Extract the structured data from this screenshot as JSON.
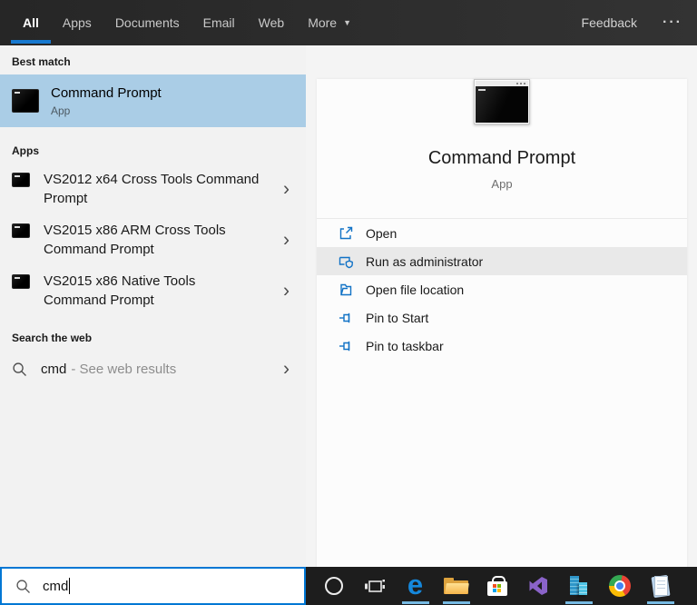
{
  "topbar": {
    "tabs": [
      {
        "label": "All",
        "active": true
      },
      {
        "label": "Apps",
        "active": false
      },
      {
        "label": "Documents",
        "active": false
      },
      {
        "label": "Email",
        "active": false
      },
      {
        "label": "Web",
        "active": false
      },
      {
        "label": "More",
        "active": false,
        "has_dropdown": true
      }
    ],
    "feedback": "Feedback",
    "overflow": "···"
  },
  "left": {
    "best_match": {
      "header": "Best match",
      "item": {
        "title": "Command Prompt",
        "subtitle": "App"
      }
    },
    "apps": {
      "header": "Apps",
      "items": [
        {
          "label": "VS2012 x64 Cross Tools Command Prompt"
        },
        {
          "label": "VS2015 x86 ARM Cross Tools Command Prompt"
        },
        {
          "label": "VS2015 x86 Native Tools Command Prompt"
        }
      ]
    },
    "web": {
      "header": "Search the web",
      "query": "cmd",
      "suffix": "- See web results"
    }
  },
  "preview": {
    "title": "Command Prompt",
    "subtitle": "App",
    "actions": [
      {
        "label": "Open",
        "highlighted": false
      },
      {
        "label": "Run as administrator",
        "highlighted": true
      },
      {
        "label": "Open file location",
        "highlighted": false
      },
      {
        "label": "Pin to Start",
        "highlighted": false
      },
      {
        "label": "Pin to taskbar",
        "highlighted": false
      }
    ]
  },
  "search": {
    "value": "cmd"
  },
  "taskbar": {
    "edge_glyph": "e",
    "icons": [
      {
        "name": "cortana",
        "running": false
      },
      {
        "name": "task-view",
        "running": false
      },
      {
        "name": "edge",
        "running": true
      },
      {
        "name": "file-explorer",
        "running": true
      },
      {
        "name": "store",
        "running": false
      },
      {
        "name": "visual-studio",
        "running": false
      },
      {
        "name": "server-manager",
        "running": true
      },
      {
        "name": "chrome",
        "running": false
      },
      {
        "name": "notepad",
        "running": true
      }
    ]
  },
  "glyphs": {
    "chevron": "›",
    "dropdown": "▼"
  },
  "colors": {
    "accent": "#0078d7",
    "best_match_highlight": "#aacde6",
    "action_highlight": "#e9e9e9",
    "topbar_bg": "#2b2b2b",
    "taskbar_bg": "#1d1d1d",
    "action_icon_blue": "#1273c6",
    "running_indicator": "#76b9e2"
  }
}
